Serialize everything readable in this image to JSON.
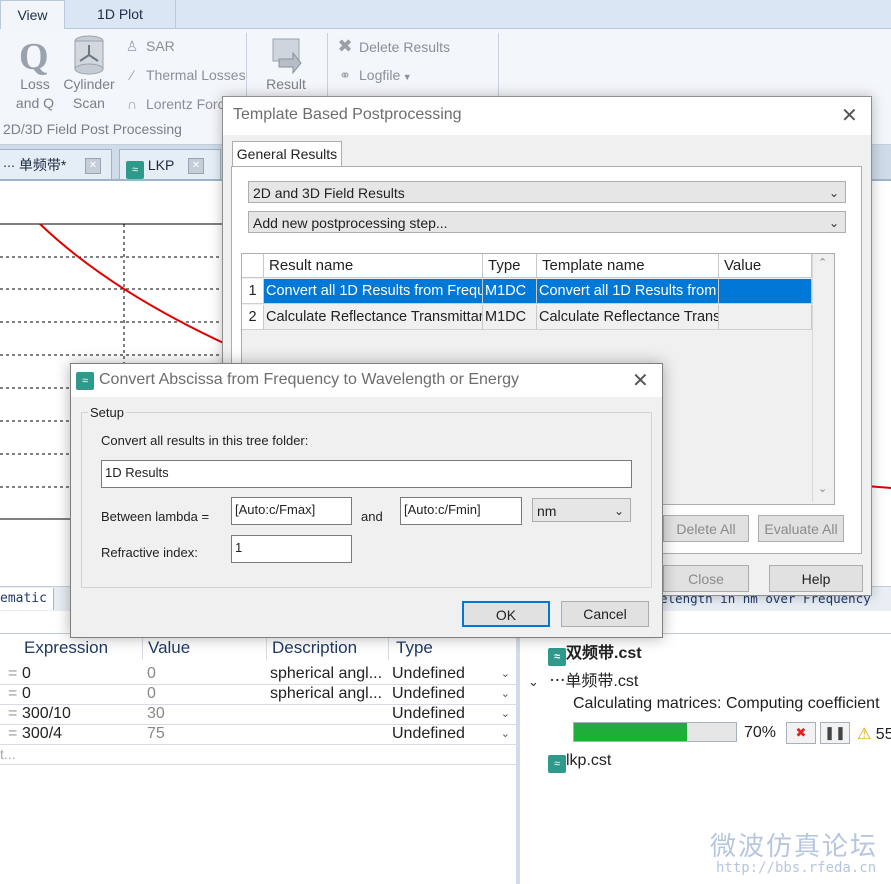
{
  "ribbon": {
    "tabs": [
      "View",
      "1D Plot"
    ],
    "loss_q": "Loss and Q",
    "cylinder_scan": "Cylinder Scan",
    "sar": "SAR",
    "thermal_losses": "Thermal Losses",
    "lorentz_force": "Lorentz Force",
    "group_label": "2D/3D Field Post Processing",
    "result": "Result",
    "delete_results": "Delete Results",
    "logfile": "Logfile"
  },
  "doc_tabs": [
    "单频带*",
    "LKP"
  ],
  "plot_tabs": {
    "left": "ematic",
    "right": "elength in nm over Frequency"
  },
  "params": {
    "headers": [
      "Expression",
      "Value",
      "Description",
      "Type"
    ],
    "rows": [
      {
        "expression": "0",
        "value": "0",
        "description": "spherical angl...",
        "type": "Undefined"
      },
      {
        "expression": "0",
        "value": "0",
        "description": "spherical angl...",
        "type": "Undefined"
      },
      {
        "expression": "300/10",
        "value": "30",
        "description": "",
        "type": "Undefined"
      },
      {
        "expression": "300/4",
        "value": "75",
        "description": "",
        "type": "Undefined"
      }
    ],
    "more": "t..."
  },
  "progress": {
    "file1": "双频带.cst",
    "file2": "单频带.cst",
    "status": "Calculating matrices: Computing coefficient",
    "percent": "70%",
    "percent_value": 0.7,
    "warn_count": "55",
    "file3": "lkp.cst"
  },
  "watermark": {
    "line1": "微波仿真论坛",
    "line2": "http://bbs.rfeda.cn"
  },
  "template_dialog": {
    "title": "Template Based Postprocessing",
    "tab": "General Results",
    "combo1": "2D and 3D Field Results",
    "combo2": "Add new postprocessing step...",
    "columns": [
      "Result name",
      "Type",
      "Template name",
      "Value"
    ],
    "rows": [
      {
        "num": "1",
        "result": "Convert all 1D Results from Frequ",
        "type": "M1DC",
        "template": "Convert all 1D Results from",
        "value": ""
      },
      {
        "num": "2",
        "result": "Calculate Reflectance Transmittar",
        "type": "M1DC",
        "template": "Calculate Reflectance Trans",
        "value": ""
      }
    ],
    "delete_all": "Delete All",
    "evaluate_all": "Evaluate All",
    "close": "Close",
    "help": "Help"
  },
  "convert_dialog": {
    "title": "Convert Abscissa from Frequency to Wavelength or Energy",
    "setup_label": "Setup",
    "folder_label": "Convert all results in this tree folder:",
    "folder_value": "1D Results",
    "between_label": "Between lambda =",
    "lambda_min": "[Auto:c/Fmax]",
    "and_label": "and",
    "lambda_max": "[Auto:c/Fmin]",
    "unit": "nm",
    "refractive_label": "Refractive index:",
    "refractive_value": "1",
    "ok": "OK",
    "cancel": "Cancel"
  },
  "colors": {
    "accent": "#0078d7",
    "progress": "#1fae3a",
    "curve": "#e00000"
  }
}
